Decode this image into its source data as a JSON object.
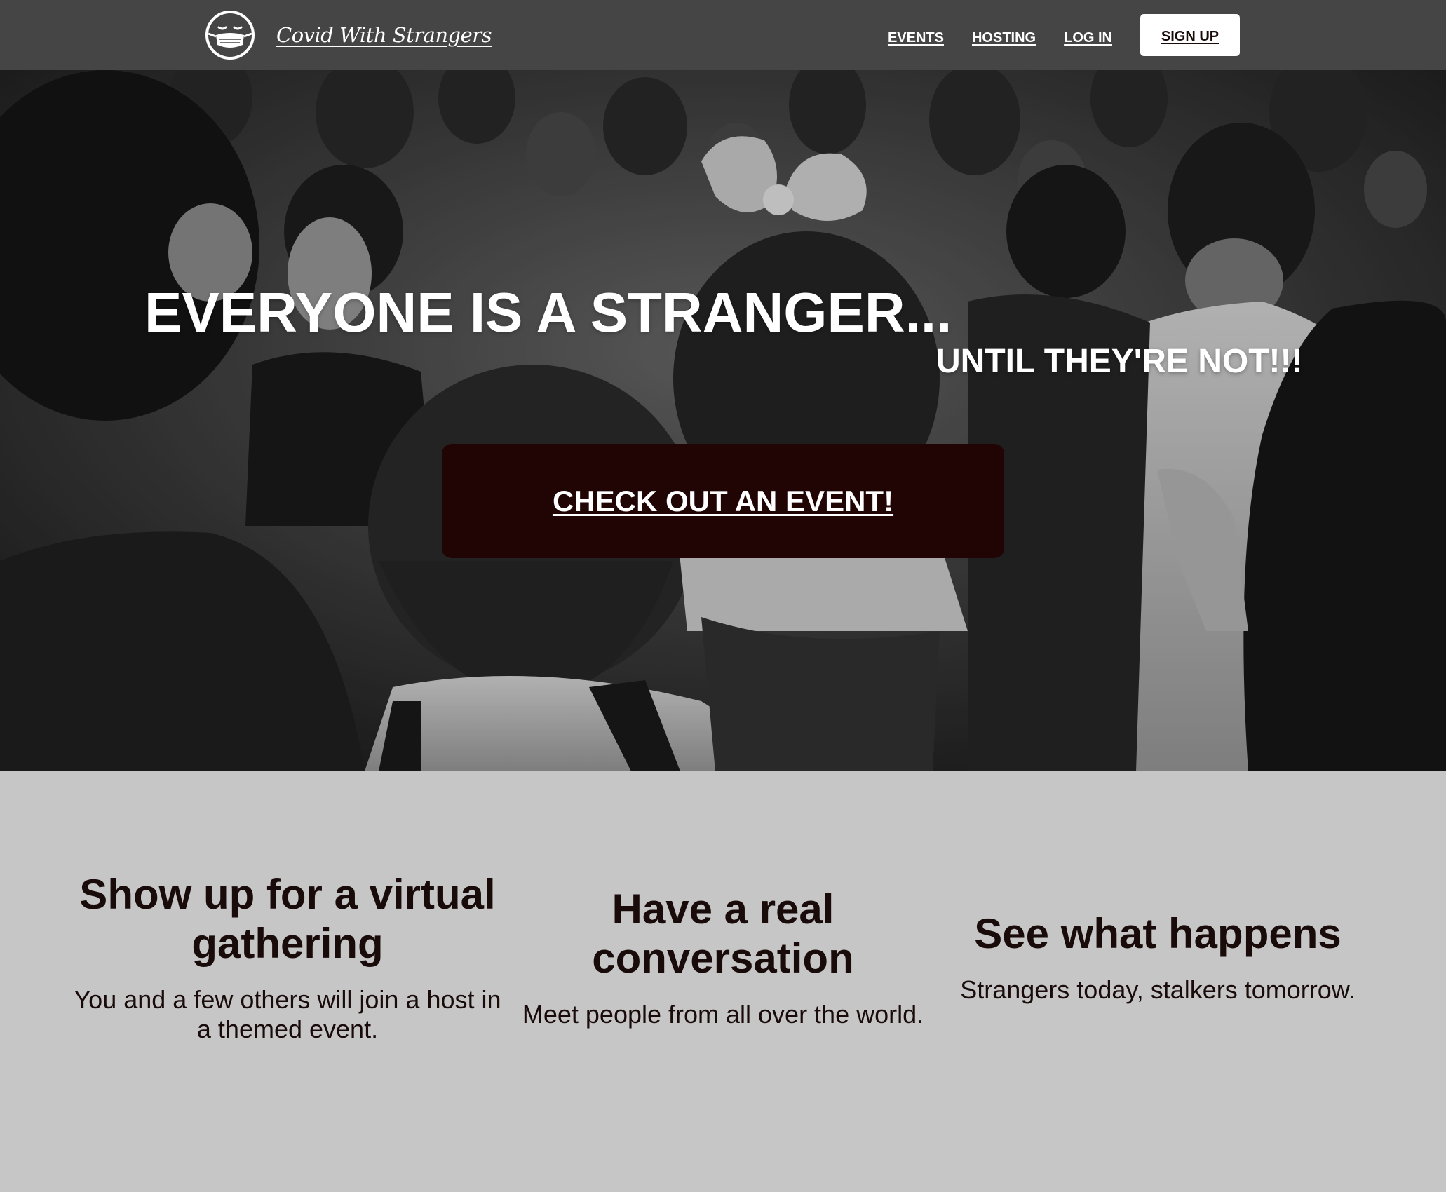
{
  "navbar": {
    "brand": {
      "name": "Covid With Strangers",
      "logo_icon": "masked-face-icon"
    },
    "links": {
      "events": "EVENTS",
      "hosting": "HOSTING",
      "login": "LOG IN",
      "signup": "SIGN UP"
    },
    "colors": {
      "background": "#454545",
      "text": "#ffffff"
    }
  },
  "hero": {
    "title": "EVERYONE IS A STRANGER...",
    "subtitle": "UNTIL THEY'RE NOT!!!",
    "cta": "CHECK OUT AN EVENT!",
    "image": "grayscale-crowd-photo",
    "colors": {
      "cta_background": "#210505",
      "text": "#ffffff"
    }
  },
  "features": [
    {
      "title": "Show up for a virtual gathering",
      "text": "You and a few others will join a host in a themed event."
    },
    {
      "title": "Have a real conversation",
      "text": "Meet people from all over the world."
    },
    {
      "title": "See what happens",
      "text": "Strangers today, stalkers tomorrow."
    }
  ],
  "colors": {
    "features_background": "#c6c6c6",
    "features_text": "#1a0b0b"
  }
}
